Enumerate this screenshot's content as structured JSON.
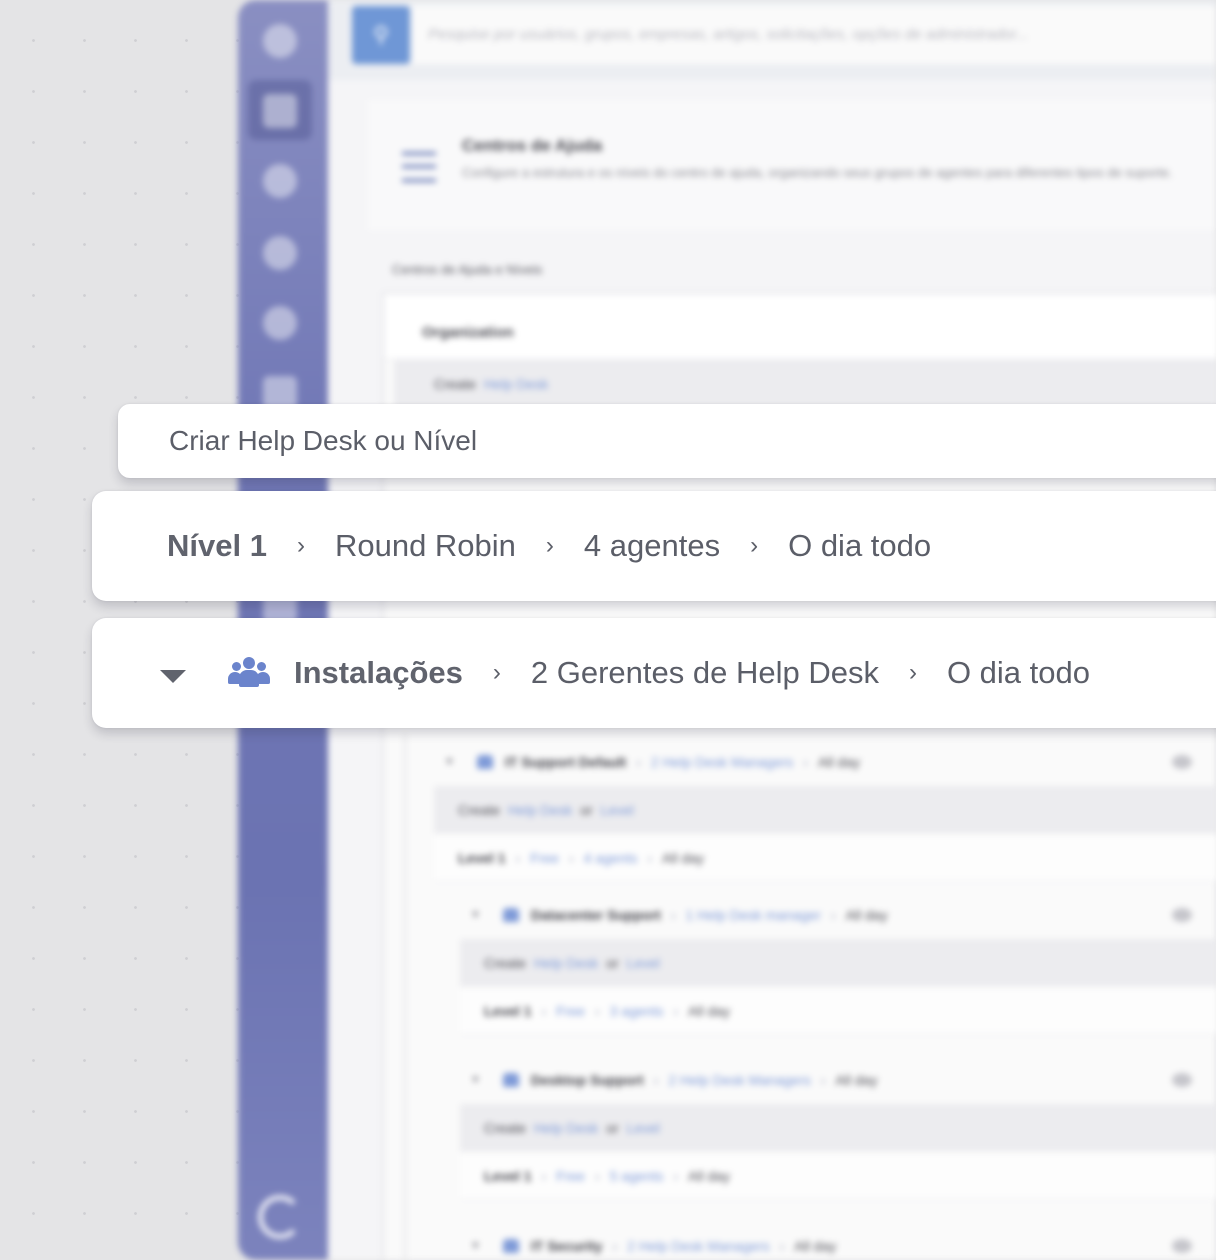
{
  "background_app": {
    "search": {
      "placeholder": "Pesquise por usuários, grupos, empresas, artigos, solicitações, opções de administrador..."
    },
    "page": {
      "title": "Centros de Ajuda",
      "description": "Configure a estrutura e os níveis do centro de ajuda, organizando seus grupos de agentes para diferentes tipos de suporte."
    },
    "section_label": "Centros de Ajuda e Níveis",
    "organization_label": "Organization",
    "create_top": {
      "create": "Create",
      "help_desk": "Help Desk"
    },
    "tree": {
      "it_support": {
        "name": "IT Support Default",
        "managers": "2 Help Desk Managers",
        "hours": "All day"
      },
      "it_create": {
        "create": "Create",
        "help_desk": "Help Desk",
        "or": "or",
        "level": "Level"
      },
      "it_level": {
        "level": "Level 1",
        "mode": "Free",
        "agents": "4 agents",
        "hours": "All day"
      },
      "datacenter": {
        "name": "Datacenter Support",
        "managers": "1 Help Desk manager",
        "hours": "All day"
      },
      "dc_create": {
        "create": "Create",
        "help_desk": "Help Desk",
        "or": "or",
        "level": "Level"
      },
      "dc_level": {
        "level": "Level 1",
        "mode": "Free",
        "agents": "3 agents",
        "hours": "All day"
      },
      "desktop": {
        "name": "Desktop Support",
        "managers": "2 Help Desk Managers",
        "hours": "All day"
      },
      "dt_create": {
        "create": "Create",
        "help_desk": "Help Desk",
        "or": "or",
        "level": "Level"
      },
      "dt_level": {
        "level": "Level 1",
        "mode": "Free",
        "agents": "5 agents",
        "hours": "All day"
      },
      "security": {
        "name": "IT Security",
        "managers": "2 Help Desk Managers",
        "hours": "All day"
      }
    }
  },
  "cards": {
    "create": {
      "label": "Criar Help Desk ou Nível"
    },
    "level": {
      "level": "Nível 1",
      "mode": "Round Robin",
      "agents": "4 agentes",
      "hours": "O dia todo"
    },
    "group": {
      "name": "Instalações",
      "managers": "2 Gerentes de Help Desk",
      "hours": "O dia todo"
    },
    "separator": "›"
  },
  "icons": {
    "search": "search-icon",
    "group": "users-group-icon",
    "caret": "caret-down-icon",
    "logo": "app-logo-icon"
  },
  "colors": {
    "accent": "#6b84cc",
    "sidebar": "#7178b6",
    "search_button": "#6f97d6"
  }
}
